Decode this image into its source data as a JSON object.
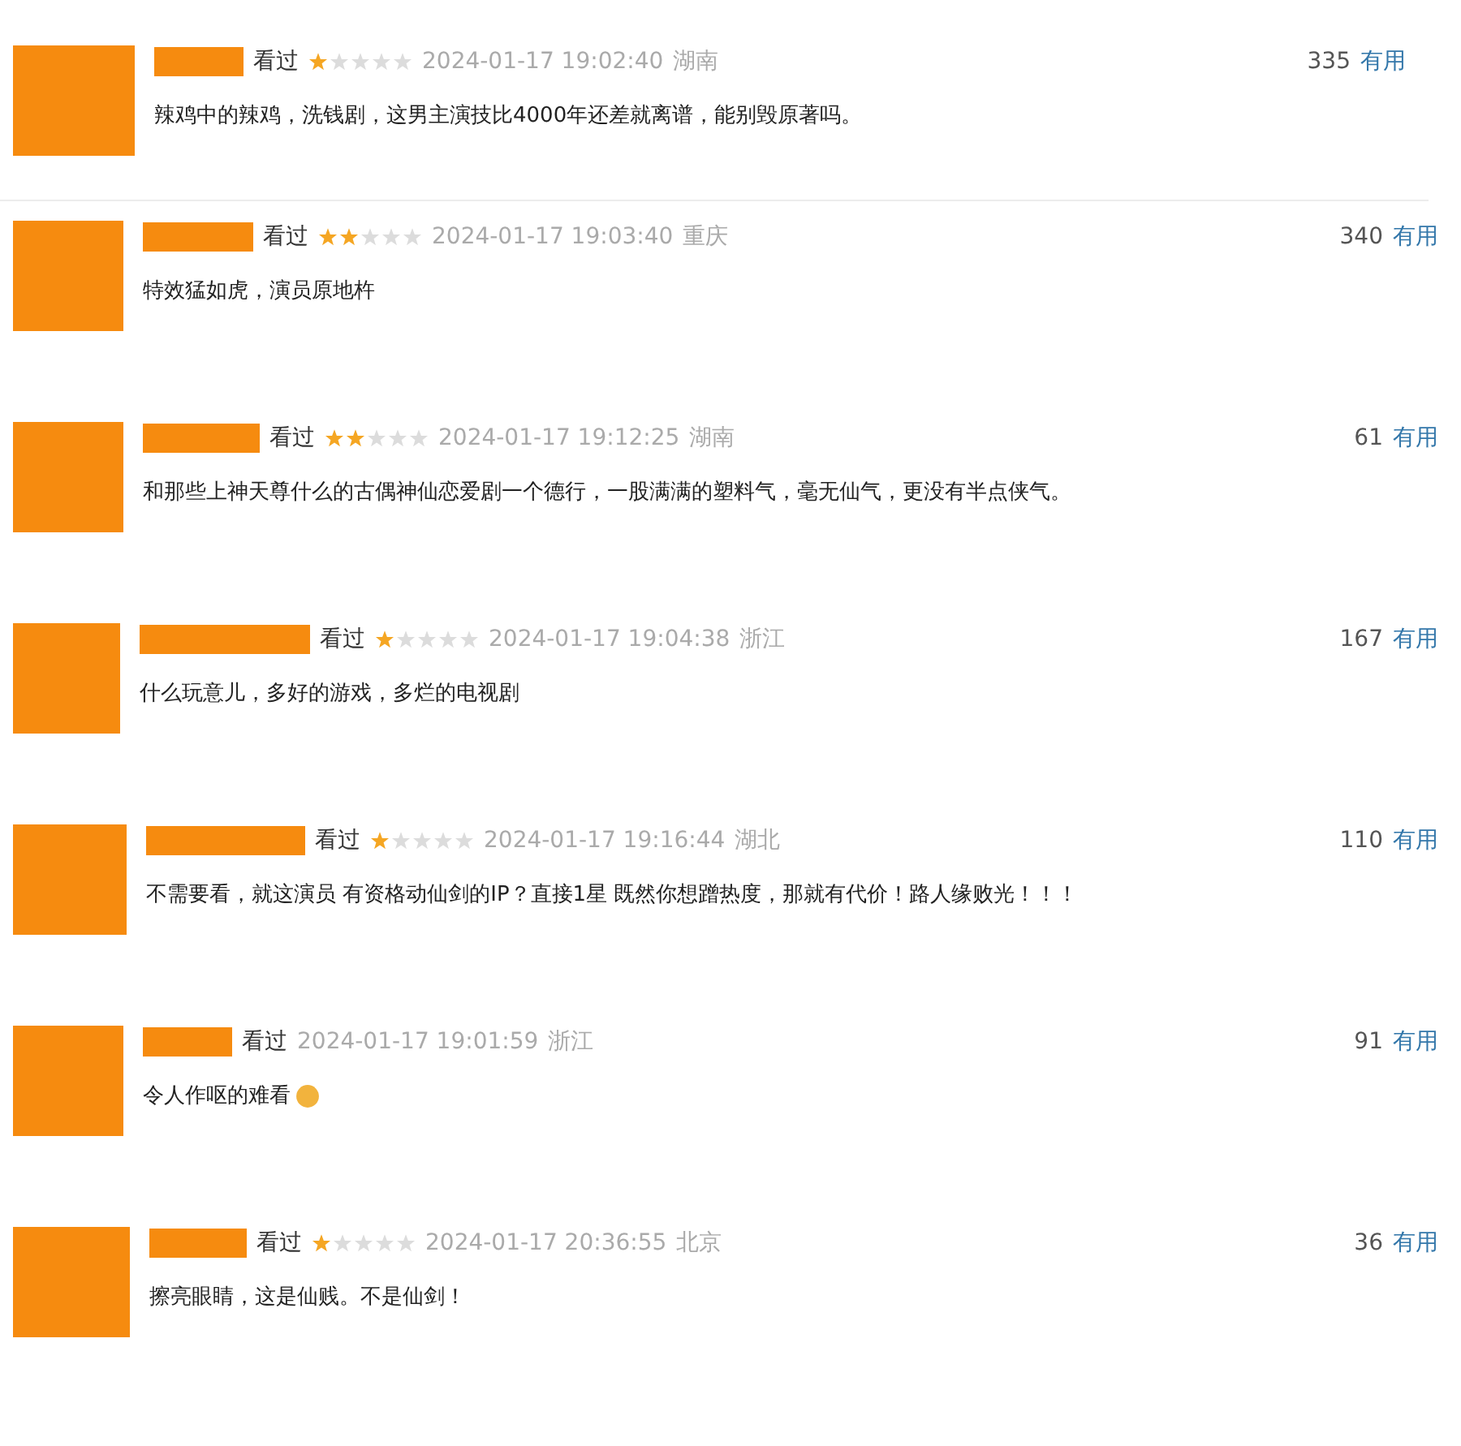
{
  "comments": [
    {
      "watched": "看过",
      "stars": 1,
      "time": "2024-01-17 19:02:40",
      "region": "湖南",
      "votes": "335",
      "useful": "有用",
      "text": "辣鸡中的辣鸡，洗钱剧，这男主演技比4000年还差就离谱，能别毁原著吗。"
    },
    {
      "watched": "看过",
      "stars": 2,
      "time": "2024-01-17 19:03:40",
      "region": "重庆",
      "votes": "340",
      "useful": "有用",
      "text": "特效猛如虎，演员原地杵"
    },
    {
      "watched": "看过",
      "stars": 2,
      "time": "2024-01-17 19:12:25",
      "region": "湖南",
      "votes": "61",
      "useful": "有用",
      "text": "和那些上神天尊什么的古偶神仙恋爱剧一个德行，一股满满的塑料气，毫无仙气，更没有半点侠气。"
    },
    {
      "watched": "看过",
      "stars": 1,
      "time": "2024-01-17 19:04:38",
      "region": "浙江",
      "votes": "167",
      "useful": "有用",
      "text": "什么玩意儿，多好的游戏，多烂的电视剧"
    },
    {
      "watched": "看过",
      "stars": 1,
      "time": "2024-01-17 19:16:44",
      "region": "湖北",
      "votes": "110",
      "useful": "有用",
      "text": "不需要看，就这演员 有资格动仙剑的IP？直接1星 既然你想蹭热度，那就有代价！路人缘败光！！！"
    },
    {
      "watched": "看过",
      "time": "2024-01-17 19:01:59",
      "region": "浙江",
      "votes": "91",
      "useful": "有用",
      "text": "令人作呕的难看",
      "emoji": true
    },
    {
      "watched": "看过",
      "stars": 1,
      "time": "2024-01-17 20:36:55",
      "region": "北京",
      "votes": "36",
      "useful": "有用",
      "text": "擦亮眼睛，这是仙贱。不是仙剑！"
    }
  ]
}
